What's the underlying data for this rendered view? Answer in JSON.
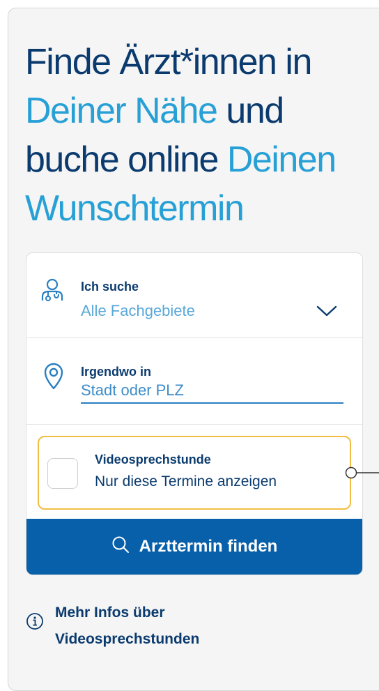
{
  "headline": {
    "part1": "Finde Ärzt*innen in ",
    "part2": "Deiner Nähe",
    "part3": " und buche online ",
    "part4": "Deinen Wunschtermin"
  },
  "search": {
    "label": "Ich suche",
    "value": "Alle Fachgebiete",
    "icon": "doctor-icon"
  },
  "location": {
    "label": "Irgendwo in",
    "placeholder": "Stadt oder PLZ",
    "value": "",
    "icon": "location-pin-icon"
  },
  "video_filter": {
    "title": "Videosprechstunde",
    "subtitle": "Nur diese Termine anzeigen",
    "checked": false
  },
  "submit": {
    "label": "Arzttermin finden",
    "icon": "search-icon"
  },
  "info": {
    "line1": "Mehr Infos über",
    "line2": "Videosprechstunden",
    "icon": "info-icon"
  },
  "colors": {
    "primary": "#0b3b6e",
    "accent": "#27a0d6",
    "button": "#0860aa",
    "highlight_border": "#f2bd42",
    "panel_bg": "#f5f5f5"
  }
}
